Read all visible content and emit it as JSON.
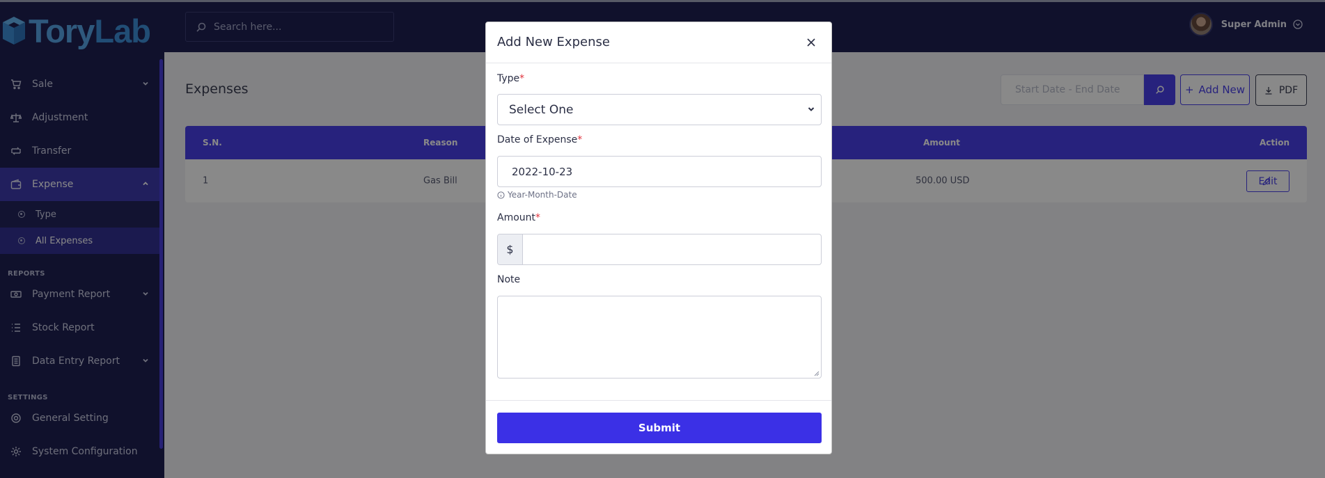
{
  "brand": {
    "part1": "Tory",
    "part2": "Lab"
  },
  "topbar": {
    "search_placeholder": "Search here...",
    "user_name": "Super Admin"
  },
  "sidebar": {
    "items": [
      {
        "label": "Sale",
        "icon": "cart-icon"
      },
      {
        "label": "Adjustment",
        "icon": "scale-icon"
      },
      {
        "label": "Transfer",
        "icon": "transfer-icon"
      },
      {
        "label": "Expense",
        "icon": "wallet-icon"
      }
    ],
    "expense_sub": [
      {
        "label": "Type"
      },
      {
        "label": "All Expenses"
      }
    ],
    "reports_title": "REPORTS",
    "reports": [
      {
        "label": "Payment Report",
        "icon": "money-icon"
      },
      {
        "label": "Stock Report",
        "icon": "list-icon"
      },
      {
        "label": "Data Entry Report",
        "icon": "document-icon"
      }
    ],
    "settings_title": "SETTINGS",
    "settings": [
      {
        "label": "General Setting",
        "icon": "settings-icon"
      },
      {
        "label": "System Configuration",
        "icon": "gear-icon"
      }
    ]
  },
  "page": {
    "title": "Expenses",
    "date_range_placeholder": "Start Date - End Date",
    "add_new_label": "Add New",
    "pdf_label": "PDF",
    "table": {
      "headers": [
        "S.N.",
        "Reason",
        "Amount",
        "Action"
      ],
      "rows": [
        {
          "sn": "1",
          "reason": "Gas Bill",
          "amount": "500.00 USD",
          "action": "Edit"
        }
      ]
    }
  },
  "modal": {
    "title": "Add New Expense",
    "type_label": "Type",
    "type_value": "Select One",
    "date_label": "Date of Expense",
    "date_value": "2022-10-23",
    "date_hint": "Year-Month-Date",
    "amount_label": "Amount",
    "amount_prefix": "$",
    "amount_value": "",
    "note_label": "Note",
    "note_value": "",
    "required_marker": "*",
    "submit_label": "Submit"
  },
  "colors": {
    "primary": "#3b30e6",
    "sidebar": "#0d0f45",
    "required": "#e0323c"
  }
}
